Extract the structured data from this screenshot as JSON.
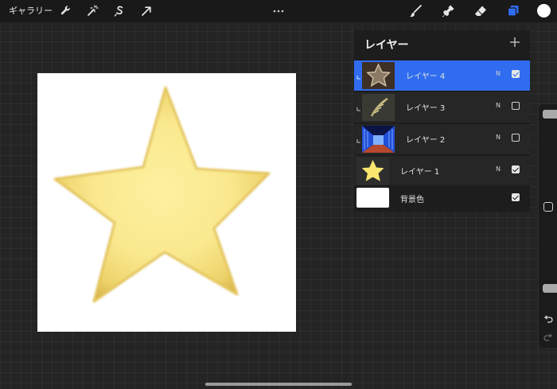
{
  "topbar": {
    "gallery_label": "ギャラリー",
    "left_tools": [
      "wrench-icon",
      "magic-wand-icon",
      "selection-s-icon",
      "transform-arrow-icon"
    ],
    "right_tools": [
      "brush-icon",
      "smudge-icon",
      "eraser-icon",
      "layers-icon"
    ],
    "active_color": "#ffffff",
    "accent": "#2f6cf0"
  },
  "layers_panel": {
    "title": "レイヤー",
    "add_icon": "plus-icon",
    "layers": [
      {
        "name": "レイヤー 4",
        "blend": "N",
        "visible": true,
        "selected": true,
        "clipped": true,
        "thumb": "dark-star"
      },
      {
        "name": "レイヤー 3",
        "blend": "N",
        "visible": false,
        "selected": false,
        "clipped": true,
        "thumb": "leaf"
      },
      {
        "name": "レイヤー 2",
        "blend": "N",
        "visible": false,
        "selected": false,
        "clipped": true,
        "thumb": "blue-corridor"
      },
      {
        "name": "レイヤー 1",
        "blend": "N",
        "visible": true,
        "selected": false,
        "clipped": false,
        "thumb": "yellow-star"
      },
      {
        "name": "背景色",
        "blend": "",
        "visible": true,
        "selected": false,
        "clipped": false,
        "thumb": "white"
      }
    ]
  },
  "canvas": {
    "background": "#ffffff",
    "star_color": "#f6e48a"
  }
}
